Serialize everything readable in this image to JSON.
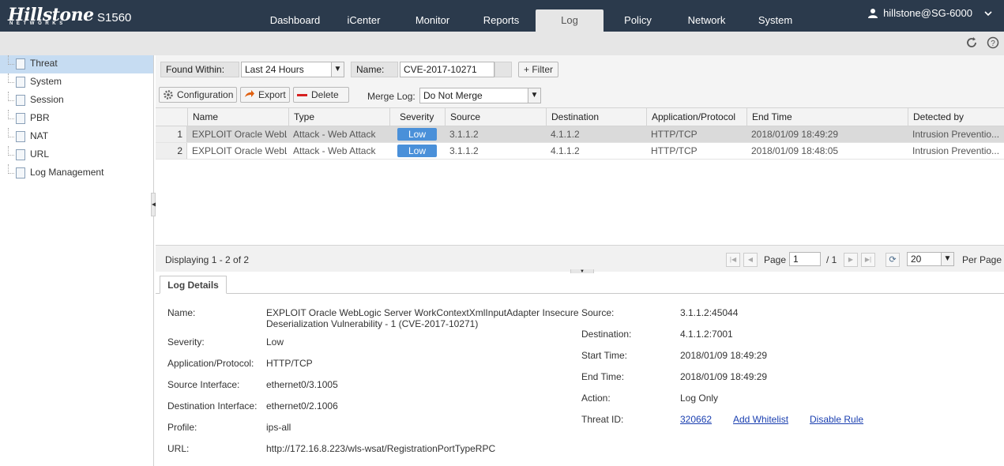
{
  "header": {
    "logo": "Hillstone",
    "logo_sub": "NETWORKS",
    "model": "S1560",
    "nav": [
      {
        "label": "Dashboard"
      },
      {
        "label": "iCenter"
      },
      {
        "label": "Monitor"
      },
      {
        "label": "Reports"
      },
      {
        "label": "Log",
        "active": true
      },
      {
        "label": "Policy"
      },
      {
        "label": "Network"
      },
      {
        "label": "System"
      }
    ],
    "user": "hillstone@SG-6000"
  },
  "sidebar": {
    "items": [
      {
        "label": "Threat",
        "active": true
      },
      {
        "label": "System"
      },
      {
        "label": "Session"
      },
      {
        "label": "PBR"
      },
      {
        "label": "NAT"
      },
      {
        "label": "URL"
      },
      {
        "label": "Log Management"
      }
    ]
  },
  "filter": {
    "found_within_label": "Found Within:",
    "found_within_value": "Last 24 Hours",
    "name_label": "Name:",
    "name_value": "CVE-2017-10271",
    "filter_button": "+ Filter"
  },
  "actions": {
    "configuration": "Configuration",
    "export": "Export",
    "delete": "Delete",
    "merge_label": "Merge Log:",
    "merge_value": "Do Not Merge"
  },
  "grid": {
    "columns": [
      "Name",
      "Type",
      "Severity",
      "Source",
      "Destination",
      "Application/Protocol",
      "End Time",
      "Detected by"
    ],
    "rows": [
      {
        "num": "1",
        "name": "EXPLOIT Oracle WebL...",
        "type": "Attack - Web Attack",
        "severity": "Low",
        "source": "3.1.1.2",
        "destination": "4.1.1.2",
        "app": "HTTP/TCP",
        "end_time": "2018/01/09 18:49:29",
        "detected_by": "Intrusion Preventio..."
      },
      {
        "num": "2",
        "name": "EXPLOIT Oracle WebL...",
        "type": "Attack - Web Attack",
        "severity": "Low",
        "source": "3.1.1.2",
        "destination": "4.1.1.2",
        "app": "HTTP/TCP",
        "end_time": "2018/01/09 18:48:05",
        "detected_by": "Intrusion Preventio..."
      }
    ]
  },
  "pager": {
    "displaying": "Displaying 1 - 2 of 2",
    "page_label": "Page",
    "page_value": "1",
    "of_label": "/ 1",
    "per_page_value": "20",
    "per_page_label": "Per Page"
  },
  "details": {
    "tab": "Log Details",
    "left": [
      {
        "label": "Name:",
        "value": "EXPLOIT Oracle WebLogic Server WorkContextXmlInputAdapter Insecure Deserialization Vulnerability - 1 (CVE-2017-10271)"
      },
      {
        "label": "Severity:",
        "value": "Low"
      },
      {
        "label": "Application/Protocol:",
        "value": "HTTP/TCP"
      },
      {
        "label": "Source Interface:",
        "value": "ethernet0/3.1005"
      },
      {
        "label": "Destination Interface:",
        "value": "ethernet0/2.1006"
      },
      {
        "label": "Profile:",
        "value": "ips-all"
      },
      {
        "label": "URL:",
        "value": "http://172.16.8.223/wls-wsat/RegistrationPortTypeRPC"
      }
    ],
    "right": [
      {
        "label": "Source:",
        "value": "3.1.1.2:45044"
      },
      {
        "label": "Destination:",
        "value": "4.1.1.2:7001"
      },
      {
        "label": "Start Time:",
        "value": "2018/01/09 18:49:29"
      },
      {
        "label": "End Time:",
        "value": "2018/01/09 18:49:29"
      },
      {
        "label": "Action:",
        "value": "Log Only"
      }
    ],
    "threat_id_label": "Threat ID:",
    "threat_id": "320662",
    "add_whitelist": "Add Whitelist",
    "disable_rule": "Disable Rule"
  }
}
